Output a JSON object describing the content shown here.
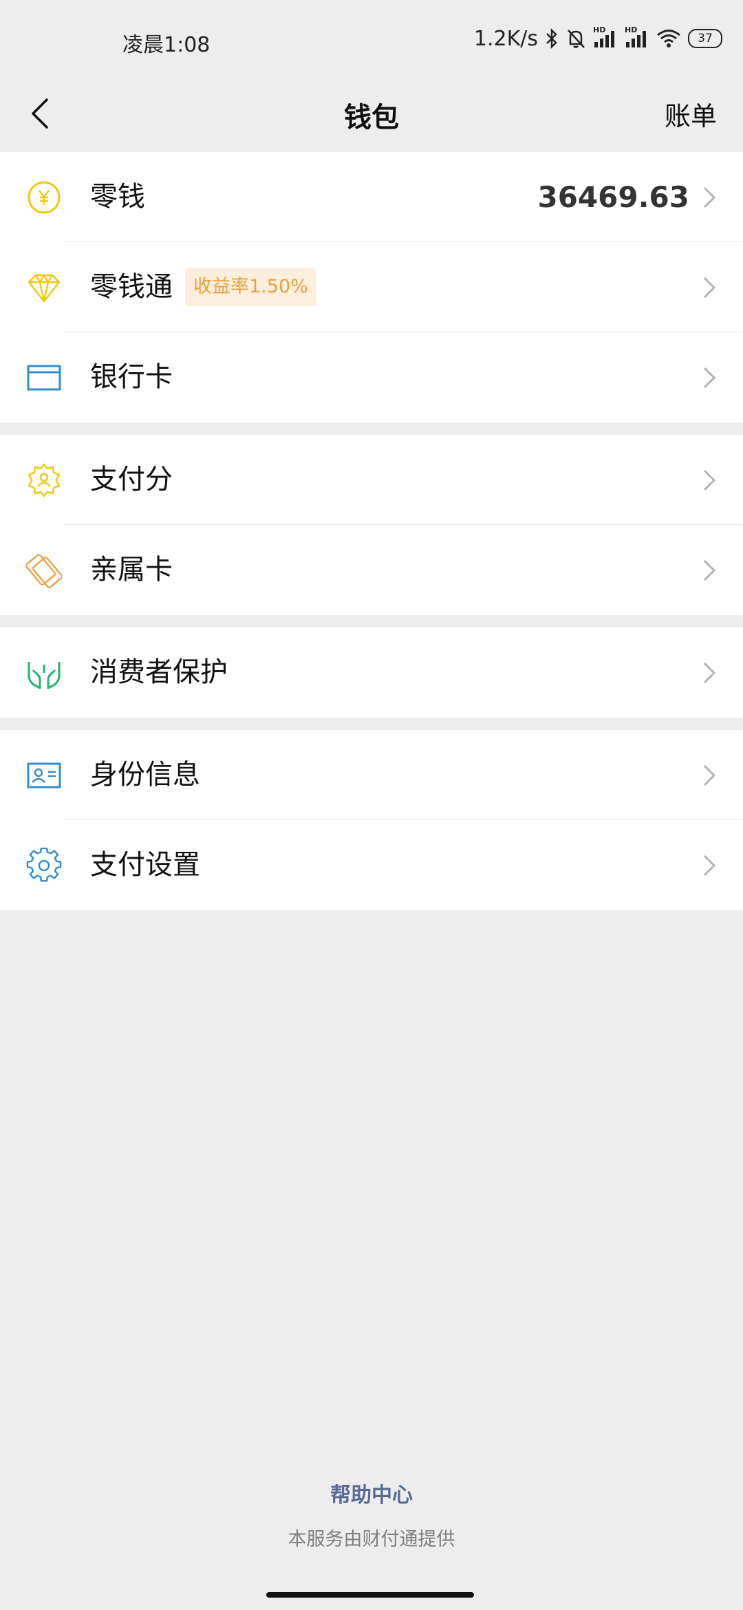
{
  "status_bar": {
    "time": "凌晨1:08",
    "net_speed": "1.2K/s",
    "signal_label_1": "HD",
    "signal_label_2": "HD",
    "battery": "37"
  },
  "nav": {
    "title": "钱包",
    "action": "账单"
  },
  "groups": [
    {
      "items": [
        {
          "label": "零钱",
          "value": "36469.63",
          "icon": "yuan-icon",
          "color": "#f2c811"
        },
        {
          "label": "零钱通",
          "badge": "收益率1.50%",
          "icon": "diamond-icon",
          "color": "#f2c811"
        },
        {
          "label": "银行卡",
          "icon": "card-icon",
          "color": "#2f8dd0"
        }
      ]
    },
    {
      "items": [
        {
          "label": "支付分",
          "icon": "badge-icon",
          "color": "#f2c811"
        },
        {
          "label": "亲属卡",
          "icon": "family-card-icon",
          "color": "#e8a54a"
        }
      ]
    },
    {
      "items": [
        {
          "label": "消费者保护",
          "icon": "hands-icon",
          "color": "#21b46d"
        }
      ]
    },
    {
      "items": [
        {
          "label": "身份信息",
          "icon": "id-card-icon",
          "color": "#2f8dd0"
        },
        {
          "label": "支付设置",
          "icon": "gear-icon",
          "color": "#2f8dd0"
        }
      ]
    }
  ],
  "footer": {
    "help": "帮助中心",
    "provider": "本服务由财付通提供"
  },
  "colors": {
    "background": "#ededed",
    "link": "#576b95",
    "badge_bg": "#fbeedd",
    "badge_text": "#e6a13e"
  }
}
